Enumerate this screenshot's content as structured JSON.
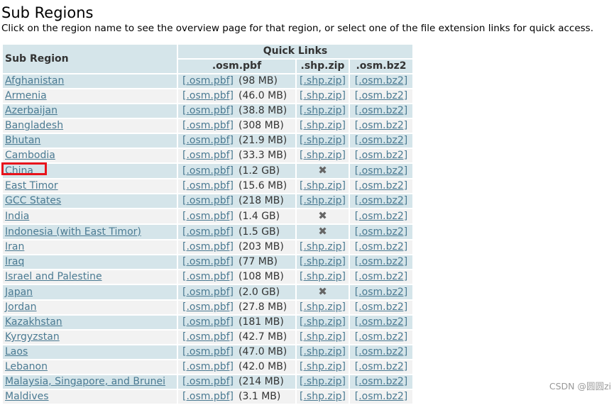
{
  "page": {
    "title": "Sub Regions",
    "subtitle": "Click on the region name to see the overview page for that region, or select one of the file extension links for quick access."
  },
  "table": {
    "header": {
      "sub_region": "Sub Region",
      "quick_links": "Quick Links",
      "pbf": ".osm.pbf",
      "shp": ".shp.zip",
      "bz2": ".osm.bz2"
    },
    "rows": [
      {
        "name": "Afghanistan",
        "pbf": "[.osm.pbf]",
        "size": "(98 MB)",
        "shp": "[.shp.zip]",
        "bz2": "[.osm.bz2]"
      },
      {
        "name": "Armenia",
        "pbf": "[.osm.pbf]",
        "size": "(46.0 MB)",
        "shp": "[.shp.zip]",
        "bz2": "[.osm.bz2]"
      },
      {
        "name": "Azerbaijan",
        "pbf": "[.osm.pbf]",
        "size": "(38.8 MB)",
        "shp": "[.shp.zip]",
        "bz2": "[.osm.bz2]"
      },
      {
        "name": "Bangladesh",
        "pbf": "[.osm.pbf]",
        "size": "(308 MB)",
        "shp": "[.shp.zip]",
        "bz2": "[.osm.bz2]"
      },
      {
        "name": "Bhutan",
        "pbf": "[.osm.pbf]",
        "size": "(21.9 MB)",
        "shp": "[.shp.zip]",
        "bz2": "[.osm.bz2]"
      },
      {
        "name": "Cambodia",
        "pbf": "[.osm.pbf]",
        "size": "(33.3 MB)",
        "shp": "[.shp.zip]",
        "bz2": "[.osm.bz2]"
      },
      {
        "name": "China",
        "pbf": "[.osm.pbf]",
        "size": "(1.2 GB)",
        "shp": "✖",
        "bz2": "[.osm.bz2]"
      },
      {
        "name": "East Timor",
        "pbf": "[.osm.pbf]",
        "size": "(15.6 MB)",
        "shp": "[.shp.zip]",
        "bz2": "[.osm.bz2]"
      },
      {
        "name": "GCC States",
        "pbf": "[.osm.pbf]",
        "size": "(218 MB)",
        "shp": "[.shp.zip]",
        "bz2": "[.osm.bz2]"
      },
      {
        "name": "India",
        "pbf": "[.osm.pbf]",
        "size": "(1.4 GB)",
        "shp": "✖",
        "bz2": "[.osm.bz2]"
      },
      {
        "name": "Indonesia (with East Timor)",
        "pbf": "[.osm.pbf]",
        "size": "(1.5 GB)",
        "shp": "✖",
        "bz2": "[.osm.bz2]"
      },
      {
        "name": "Iran",
        "pbf": "[.osm.pbf]",
        "size": "(203 MB)",
        "shp": "[.shp.zip]",
        "bz2": "[.osm.bz2]"
      },
      {
        "name": "Iraq",
        "pbf": "[.osm.pbf]",
        "size": "(77 MB)",
        "shp": "[.shp.zip]",
        "bz2": "[.osm.bz2]"
      },
      {
        "name": "Israel and Palestine",
        "pbf": "[.osm.pbf]",
        "size": "(108 MB)",
        "shp": "[.shp.zip]",
        "bz2": "[.osm.bz2]"
      },
      {
        "name": "Japan",
        "pbf": "[.osm.pbf]",
        "size": "(2.0 GB)",
        "shp": "✖",
        "bz2": "[.osm.bz2]"
      },
      {
        "name": "Jordan",
        "pbf": "[.osm.pbf]",
        "size": "(27.8 MB)",
        "shp": "[.shp.zip]",
        "bz2": "[.osm.bz2]"
      },
      {
        "name": "Kazakhstan",
        "pbf": "[.osm.pbf]",
        "size": "(181 MB)",
        "shp": "[.shp.zip]",
        "bz2": "[.osm.bz2]"
      },
      {
        "name": "Kyrgyzstan",
        "pbf": "[.osm.pbf]",
        "size": "(42.7 MB)",
        "shp": "[.shp.zip]",
        "bz2": "[.osm.bz2]"
      },
      {
        "name": "Laos",
        "pbf": "[.osm.pbf]",
        "size": "(47.0 MB)",
        "shp": "[.shp.zip]",
        "bz2": "[.osm.bz2]"
      },
      {
        "name": "Lebanon",
        "pbf": "[.osm.pbf]",
        "size": "(42.0 MB)",
        "shp": "[.shp.zip]",
        "bz2": "[.osm.bz2]"
      },
      {
        "name": "Malaysia, Singapore, and Brunei",
        "pbf": "[.osm.pbf]",
        "size": "(214 MB)",
        "shp": "[.shp.zip]",
        "bz2": "[.osm.bz2]"
      },
      {
        "name": "Maldives",
        "pbf": "[.osm.pbf]",
        "size": "(3.1 MB)",
        "shp": "[.shp.zip]",
        "bz2": "[.osm.bz2]"
      }
    ]
  },
  "watermark": "CSDN @圆圆zi",
  "colors": {
    "link": "#4a7a92",
    "row_blue": "#d5e5ea",
    "row_grey": "#f2f2f2",
    "highlight_box": "#e8141c"
  },
  "icons": {
    "unavailable": "x-mark-icon"
  }
}
